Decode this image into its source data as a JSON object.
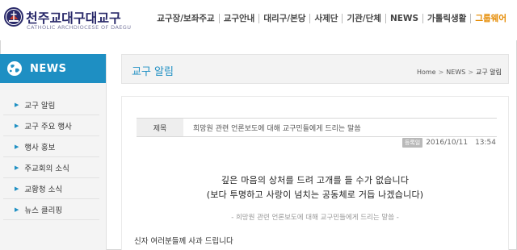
{
  "brand": {
    "name_ko": "천주교대구대교구",
    "name_en": "CATHOLIC ARCHDIOCESE OF DAEGU"
  },
  "topnav": [
    {
      "label": "교구장/보좌주교"
    },
    {
      "label": "교구안내"
    },
    {
      "label": "대리구/본당"
    },
    {
      "label": "사제단"
    },
    {
      "label": "기관/단체"
    },
    {
      "label": "NEWS"
    },
    {
      "label": "가톨릭생활"
    },
    {
      "label": "그룹웨어"
    }
  ],
  "colors": {
    "accent": "#1e8fc3",
    "nav_highlight": "#e58a00",
    "brand": "#2a2a6a"
  },
  "sidebar": {
    "title": "NEWS",
    "icon": "globe-icon",
    "items": [
      {
        "label": "교구 알림"
      },
      {
        "label": "교구 주요 행사"
      },
      {
        "label": "행사 홍보"
      },
      {
        "label": "주교회의 소식"
      },
      {
        "label": "교황청 소식"
      },
      {
        "label": "뉴스 클리핑"
      }
    ]
  },
  "main": {
    "page_title": "교구 알림",
    "breadcrumb": {
      "home": "Home",
      "sep": ">",
      "section": "NEWS",
      "current": "교구 알림"
    }
  },
  "article": {
    "subject_label": "제목",
    "subject": "희망원 관련 언론보도에 대해 교구민들에게 드리는 말씀",
    "badge": "등록일",
    "date": "2016/10/11",
    "time": "13:54",
    "headline_1": "깊은 마음의 상처를 드려 고개를 들 수가 없습니다",
    "headline_2": "(보다 투명하고 사랑이 넘치는 공동체로 거듭 나겠습니다)",
    "subheading": "- 희망원 관련 언론보도에 대해 교구민들에게 드리는 말씀 -",
    "greeting": "신자 여러분들께 사과 드립니다"
  }
}
